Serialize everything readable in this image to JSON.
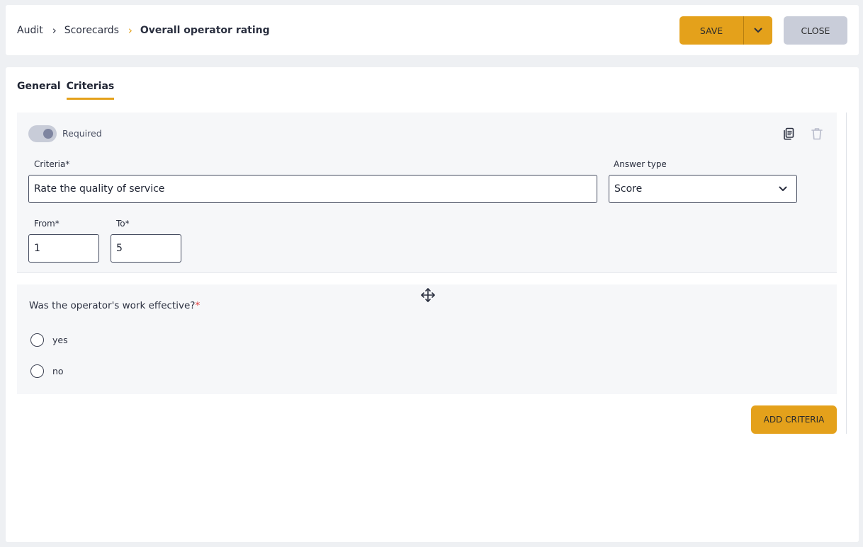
{
  "breadcrumb": {
    "items": [
      "Audit",
      "Scorecards"
    ],
    "current": "Overall operator rating",
    "separator": "›"
  },
  "toolbar": {
    "save_label": "SAVE",
    "close_label": "CLOSE"
  },
  "tabs": [
    {
      "label": "General",
      "active": false
    },
    {
      "label": "Criterias",
      "active": true
    }
  ],
  "criteria_card": {
    "required_label": "Required",
    "required_on": true,
    "criteria_label": "Criteria*",
    "criteria_value": "Rate the quality of service",
    "answer_type_label": "Answer type",
    "answer_type_value": "Score",
    "from_label": "From*",
    "from_value": "1",
    "to_label": "To*",
    "to_value": "5"
  },
  "question_card": {
    "question": "Was the operator's work effective?",
    "required_mark": "*",
    "options": [
      "yes",
      "no"
    ]
  },
  "add_criteria_label": "ADD CRITERIA",
  "colors": {
    "accent": "#e4a11b",
    "close_button": "#c9cdd9",
    "required_mark": "#e03a3a"
  }
}
